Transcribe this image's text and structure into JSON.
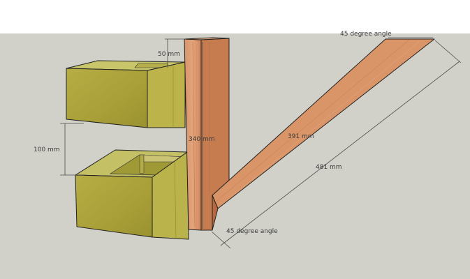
{
  "scene": {
    "colors": {
      "sky": "#ffffff",
      "ground": "#d1d1ca",
      "block_top": "#c7c46a",
      "block_front": "#a8a13a",
      "block_side": "#bdb64c",
      "wood_front": "#d58b5e",
      "wood_side": "#c4764a",
      "wood_light": "#e1a07a"
    }
  },
  "dimensions": {
    "top_angle": "45 degree angle",
    "bottom_angle": "45 degree angle",
    "gap_top": "50 mm",
    "block_gap": "100 mm",
    "post_height": "340 mm",
    "brace_inner": "391 mm",
    "brace_outer": "481 mm"
  }
}
